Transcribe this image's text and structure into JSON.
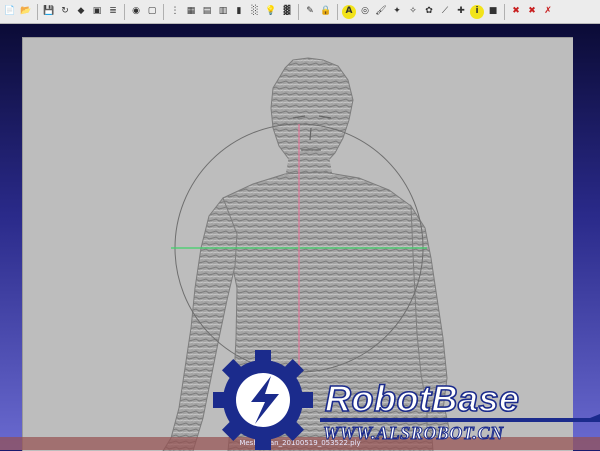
{
  "toolbar": {
    "buttons": [
      {
        "icon": "new-project-icon",
        "glyph": "📄"
      },
      {
        "icon": "open-folder-icon",
        "glyph": "📂"
      },
      {
        "icon": "save-icon",
        "glyph": "💾"
      },
      {
        "icon": "reload-icon",
        "glyph": "↻"
      },
      {
        "icon": "diamond-icon",
        "glyph": "◆"
      },
      {
        "icon": "snapshot-icon",
        "glyph": "▣"
      },
      {
        "icon": "layers-icon",
        "glyph": "≣"
      },
      {
        "icon": "help-icon",
        "glyph": "◉"
      },
      {
        "icon": "box-icon",
        "glyph": "▢"
      },
      {
        "icon": "points-icon",
        "glyph": "⋮"
      },
      {
        "icon": "wireframe-icon",
        "glyph": "▦"
      },
      {
        "icon": "flat-lines-icon",
        "glyph": "▤"
      },
      {
        "icon": "flat-icon",
        "glyph": "▥"
      },
      {
        "icon": "smooth-icon",
        "glyph": "▮"
      },
      {
        "icon": "texture-icon",
        "glyph": "░"
      },
      {
        "icon": "light-bulb-icon",
        "glyph": "💡"
      },
      {
        "icon": "color-icon",
        "glyph": "▓"
      },
      {
        "icon": "annotation-icon",
        "glyph": "✎"
      },
      {
        "icon": "lock-icon",
        "glyph": "🔒"
      },
      {
        "icon": "text-label-icon",
        "glyph": "A"
      },
      {
        "icon": "globe-icon",
        "glyph": "◎"
      },
      {
        "icon": "brush-icon",
        "glyph": "🖌"
      },
      {
        "icon": "select-vertices-icon",
        "glyph": "✦"
      },
      {
        "icon": "select-faces-icon",
        "glyph": "✧"
      },
      {
        "icon": "paint-icon",
        "glyph": "✿"
      },
      {
        "icon": "measure-icon",
        "glyph": "⟋"
      },
      {
        "icon": "align-icon",
        "glyph": "✚"
      },
      {
        "icon": "info-icon",
        "glyph": "i"
      },
      {
        "icon": "render-icon",
        "glyph": "■"
      },
      {
        "icon": "delete-vertex-icon",
        "glyph": "✖"
      },
      {
        "icon": "delete-face-icon",
        "glyph": "✖"
      },
      {
        "icon": "delete-selection-icon",
        "glyph": "✗"
      }
    ],
    "separators_after": [
      1,
      6,
      8,
      16,
      18,
      28
    ]
  },
  "status": {
    "mesh_info": "Mesh: scan_20100519_053522.ply"
  },
  "watermark": {
    "title": "RobotBase",
    "url": "WWW.ALSROBOT.CN"
  },
  "colors": {
    "viewport_bg": "#bdbdbd",
    "trackball": "#6e6e6e",
    "axis_horizontal": "#3fd16a",
    "axis_vertical": "#e07a9a",
    "mesh": "#9d9d9d",
    "logo_blue": "#1b2b8c"
  }
}
